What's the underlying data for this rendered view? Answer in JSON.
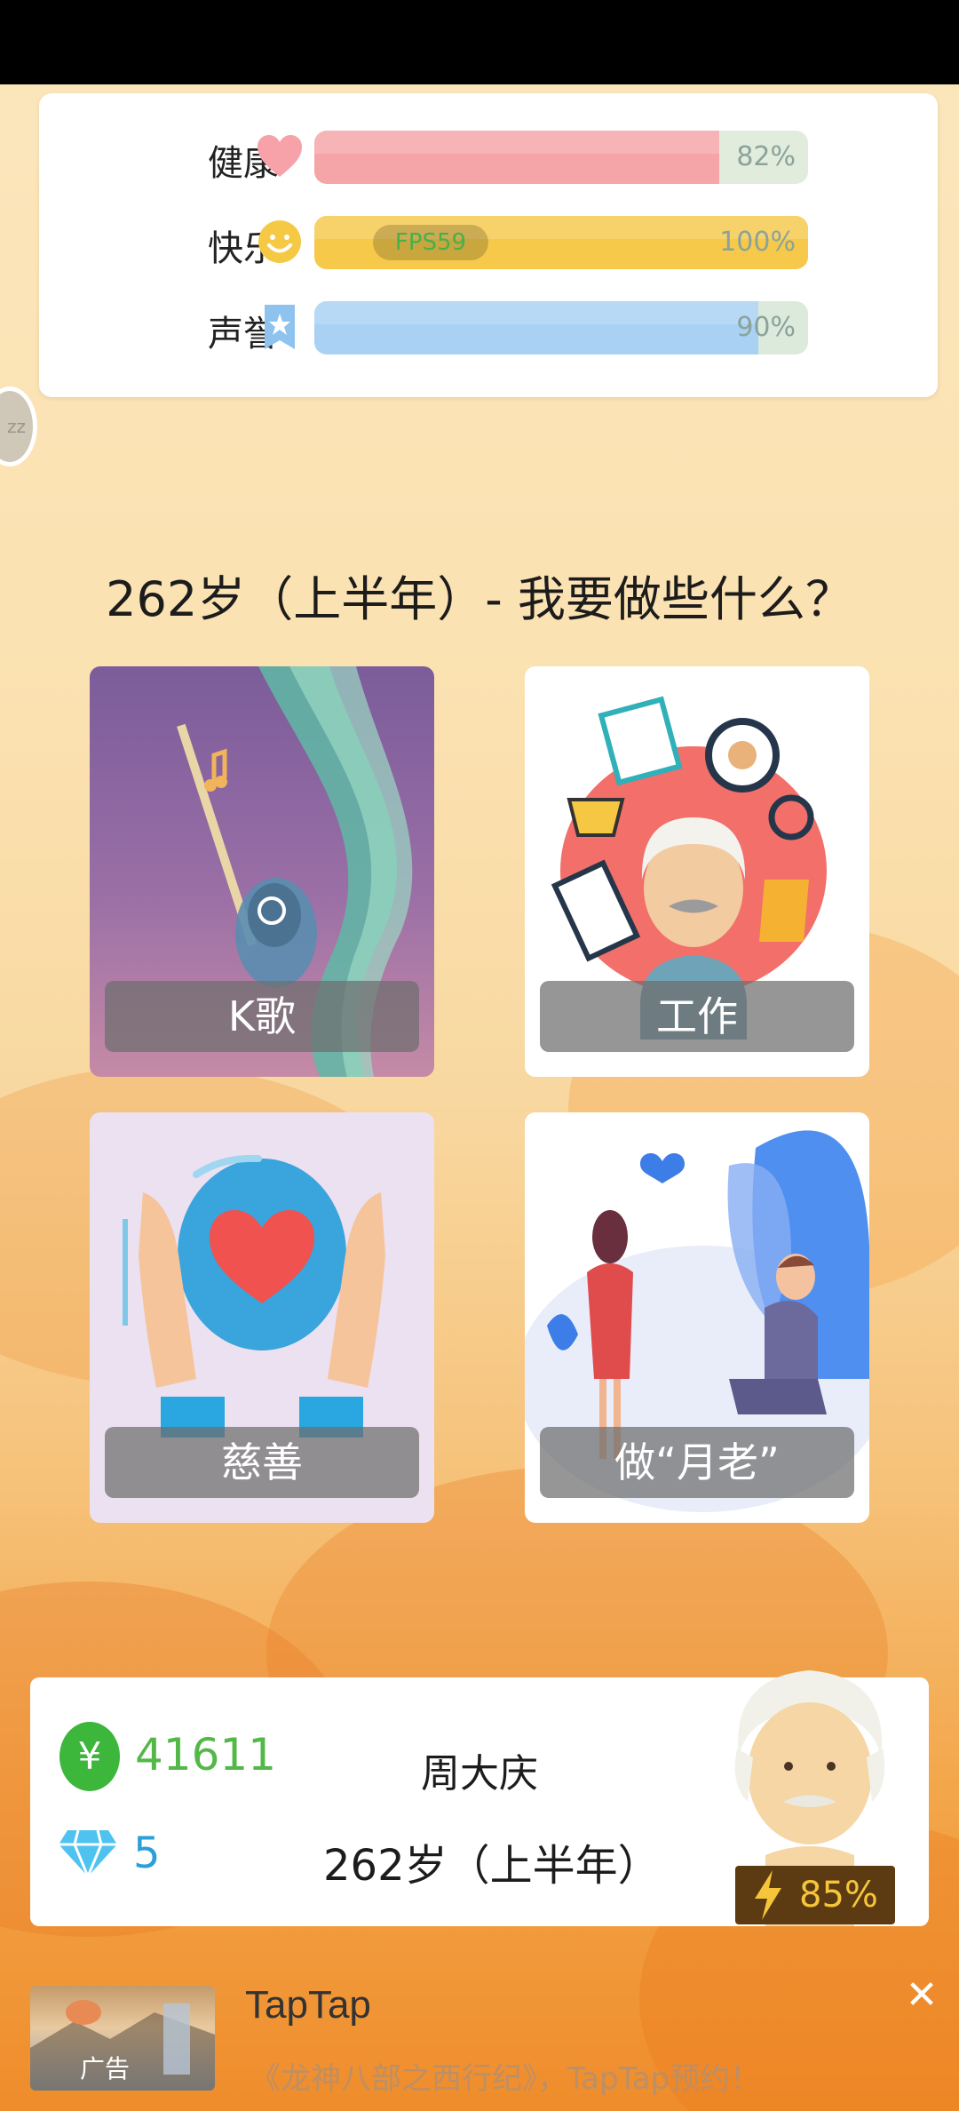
{
  "stats": [
    {
      "label": "健康",
      "percent": 82,
      "percent_text": "82%",
      "icon": "heart-icon",
      "bar_color": "#f5a4a8",
      "track_color": "#e1ecdd"
    },
    {
      "label": "快乐",
      "percent": 100,
      "percent_text": "100%",
      "icon": "smiley-icon",
      "bar_color": "#f6c94a",
      "track_color": "#f1d98a"
    },
    {
      "label": "声誉",
      "percent": 90,
      "percent_text": "90%",
      "icon": "star-ribbon-icon",
      "bar_color": "#a9d1f4",
      "track_color": "#dbeadb"
    }
  ],
  "fps_text": "FPS59",
  "side_button_text": "zz",
  "question": "262岁（上半年）- 我要做些什么？",
  "activities": [
    {
      "label": "K歌",
      "icon": "guitar-icon"
    },
    {
      "label": "工作",
      "icon": "work-icon"
    },
    {
      "label": "慈善",
      "icon": "charity-heart-icon"
    },
    {
      "label": "做“月老”",
      "icon": "matchmaker-icon"
    }
  ],
  "player": {
    "money": "41611",
    "name": "周大庆",
    "gems": "5",
    "age": "262岁（上半年）",
    "energy_text": "85%",
    "money_icon_glyph": "¥"
  },
  "ad": {
    "label": "广告",
    "title": "TapTap",
    "description": "《龙神八部之西行纪》，TapTap预约！",
    "close_glyph": "✕"
  }
}
